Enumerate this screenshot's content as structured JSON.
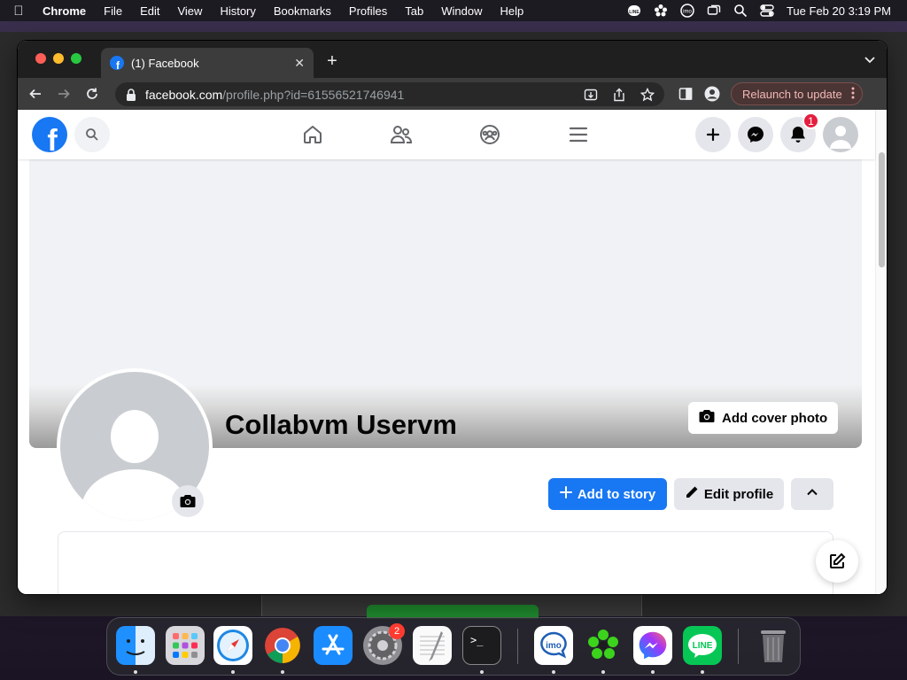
{
  "menubar": {
    "app_name": "Chrome",
    "menus": [
      "File",
      "Edit",
      "View",
      "History",
      "Bookmarks",
      "Profiles",
      "Tab",
      "Window",
      "Help"
    ],
    "clock": "Tue Feb 20  3:19 PM"
  },
  "browser": {
    "tab_title": "(1) Facebook",
    "url_host": "facebook.com",
    "url_path": "/profile.php?id=61556521746941",
    "relaunch_label": "Relaunch to update"
  },
  "facebook": {
    "notification_count": "1",
    "add_cover_label": "Add cover photo",
    "profile_name": "Collabvm Uservm",
    "add_story_label": "Add to story",
    "edit_profile_label": "Edit profile"
  },
  "dock": {
    "apps": [
      "Finder",
      "Launchpad",
      "Safari",
      "Google Chrome",
      "App Store",
      "System Settings",
      "TextEdit",
      "Terminal",
      "imo",
      "ICQ",
      "Messenger",
      "LINE",
      "Trash"
    ],
    "settings_badge": "2"
  },
  "colors": {
    "facebook_blue": "#1877f2",
    "notification_red": "#e41e3f"
  }
}
